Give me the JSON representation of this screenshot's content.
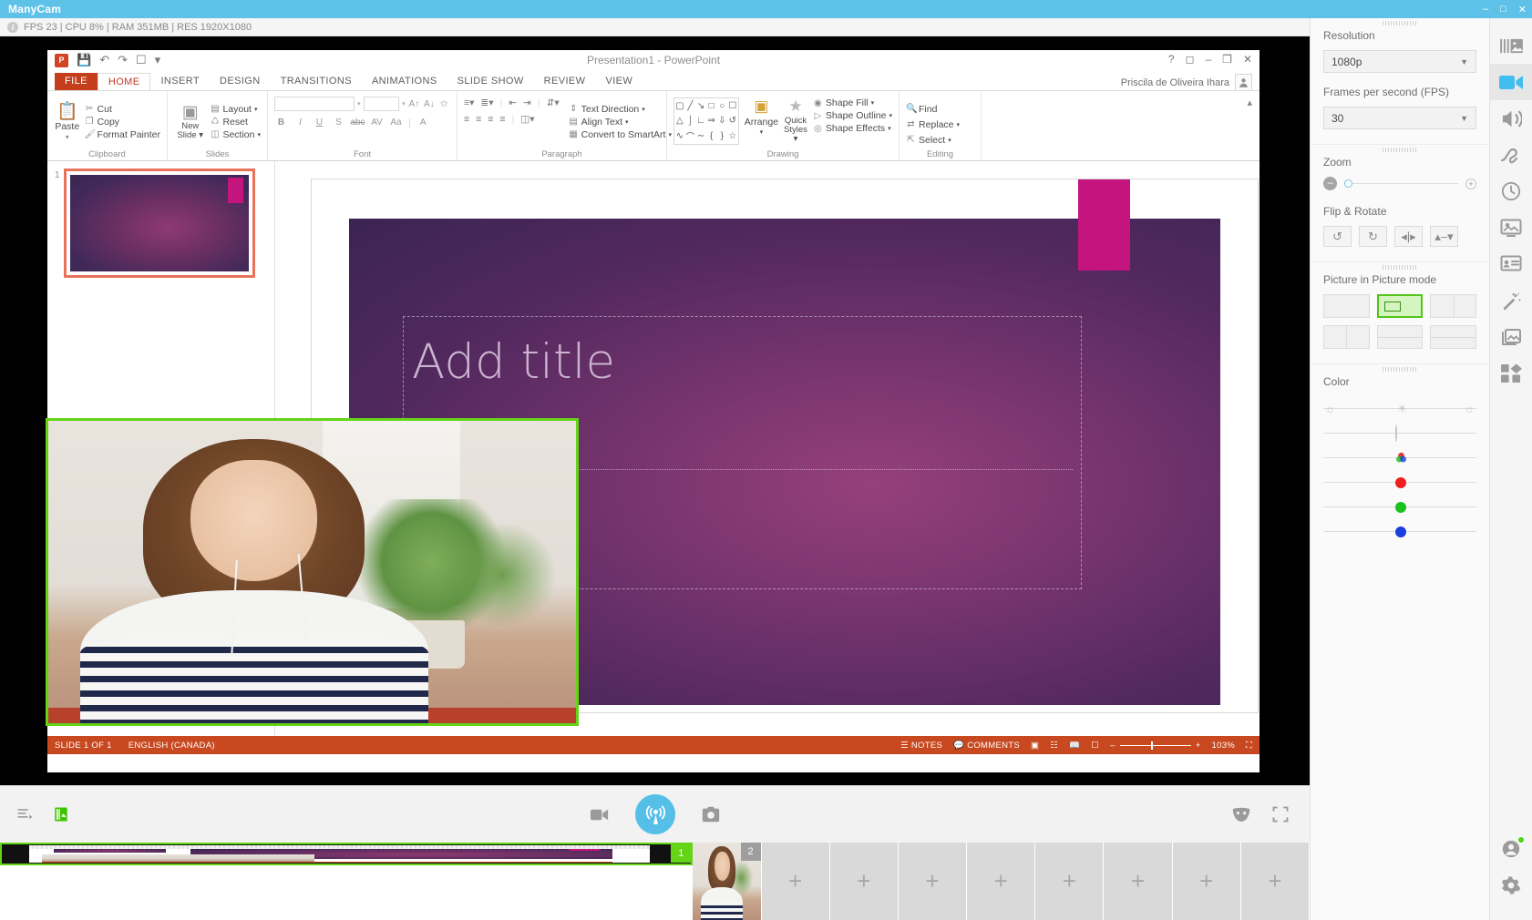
{
  "window": {
    "app_title": "ManyCam",
    "minimize": "–",
    "maximize": "□",
    "close": "✕"
  },
  "stats_bar": {
    "info_icon": "info-icon",
    "text": "FPS 23 | CPU 8% | RAM 351MB | RES 1920X1080"
  },
  "powerpoint": {
    "title": "Presentation1 - PowerPoint",
    "user": "Priscila de Oliveira Ihara",
    "quick_access": [
      "save-icon",
      "undo-icon",
      "redo-icon",
      "start-from-beginning-icon",
      "customize-icon"
    ],
    "window_controls": [
      "help-icon",
      "ribbon-display-icon",
      "minimize-icon",
      "restore-icon",
      "close-icon"
    ],
    "tabs": [
      {
        "label": "FILE",
        "kind": "file"
      },
      {
        "label": "HOME",
        "kind": "active"
      },
      {
        "label": "INSERT",
        "kind": "normal"
      },
      {
        "label": "DESIGN",
        "kind": "normal"
      },
      {
        "label": "TRANSITIONS",
        "kind": "normal"
      },
      {
        "label": "ANIMATIONS",
        "kind": "normal"
      },
      {
        "label": "SLIDE SHOW",
        "kind": "normal"
      },
      {
        "label": "REVIEW",
        "kind": "normal"
      },
      {
        "label": "VIEW",
        "kind": "normal"
      }
    ],
    "ribbon": {
      "clipboard": {
        "name": "Clipboard",
        "paste": "Paste",
        "items": [
          "Cut",
          "Copy",
          "Format Painter"
        ]
      },
      "slides": {
        "name": "Slides",
        "new_slide": "New\nSlide",
        "items": [
          "Layout",
          "Reset",
          "Section"
        ]
      },
      "font": {
        "name": "Font",
        "font_name": "",
        "font_size": "",
        "buttons": [
          "B",
          "I",
          "U",
          "S",
          "abc",
          "AV",
          "Aa",
          "A"
        ]
      },
      "paragraph": {
        "name": "Paragraph",
        "items": [
          "Text Direction",
          "Align Text",
          "Convert to SmartArt"
        ]
      },
      "drawing": {
        "name": "Drawing",
        "arrange": "Arrange",
        "quick_styles": "Quick\nStyles",
        "items": [
          "Shape Fill",
          "Shape Outline",
          "Shape Effects"
        ]
      },
      "editing": {
        "name": "Editing",
        "items": [
          "Find",
          "Replace",
          "Select"
        ]
      }
    },
    "slide_thumbnail_number": "1",
    "slide_title_placeholder": "Add title",
    "status_bar": {
      "slide_count": "SLIDE 1 OF 1",
      "language": "ENGLISH (CANADA)",
      "notes": "NOTES",
      "comments": "COMMENTS",
      "view_icons": [
        "normal-view-icon",
        "slide-sorter-icon",
        "reading-view-icon",
        "slide-show-icon"
      ],
      "zoom_minus": "–",
      "zoom_plus": "+",
      "zoom_level": "103%",
      "fit_icon": "fit-slide-icon"
    }
  },
  "bottom_toolbar": {
    "left": [
      "playlist-icon",
      "effects-layers-icon"
    ],
    "center": [
      "record-video-icon",
      "broadcast-icon",
      "snapshot-icon"
    ],
    "right": [
      "mask-icon",
      "fullscreen-icon"
    ]
  },
  "sources": [
    {
      "number": "1",
      "selected": true,
      "kind": "powerpoint-capture"
    },
    {
      "number": "2",
      "selected": false,
      "kind": "webcam"
    },
    {
      "number": "",
      "selected": false,
      "kind": "add",
      "label": "+"
    },
    {
      "number": "",
      "selected": false,
      "kind": "add",
      "label": "+"
    },
    {
      "number": "",
      "selected": false,
      "kind": "add",
      "label": "+"
    },
    {
      "number": "",
      "selected": false,
      "kind": "add",
      "label": "+"
    },
    {
      "number": "",
      "selected": false,
      "kind": "add",
      "label": "+"
    },
    {
      "number": "",
      "selected": false,
      "kind": "add",
      "label": "+"
    },
    {
      "number": "",
      "selected": false,
      "kind": "add",
      "label": "+"
    },
    {
      "number": "",
      "selected": false,
      "kind": "add",
      "label": "+"
    }
  ],
  "settings_panel": {
    "resolution": {
      "label": "Resolution",
      "value": "1080p"
    },
    "fps": {
      "label": "Frames per second (FPS)",
      "value": "30"
    },
    "zoom": {
      "label": "Zoom",
      "minus": "–",
      "plus": "+",
      "value_pct": 3
    },
    "flip_rotate": {
      "label": "Flip & Rotate",
      "buttons": [
        "rotate-left-icon",
        "rotate-right-icon",
        "flip-horizontal-icon",
        "flip-vertical-icon"
      ]
    },
    "pip": {
      "label": "Picture in Picture mode",
      "options": [
        {
          "name": "pip-mode-fullscreen",
          "selected": false
        },
        {
          "name": "pip-mode-overlay",
          "selected": true
        },
        {
          "name": "pip-mode-side-by-side",
          "selected": false
        },
        {
          "name": "pip-mode-split-vertical",
          "selected": false
        },
        {
          "name": "pip-mode-split-horizontal",
          "selected": false
        },
        {
          "name": "pip-mode-stacked",
          "selected": false
        }
      ]
    },
    "color": {
      "label": "Color",
      "sliders": [
        {
          "name": "brightness",
          "icon": "sun-icon",
          "pos_pct": 48,
          "color": "#e2e2e2"
        },
        {
          "name": "contrast",
          "icon": "contrast-icon",
          "pos_pct": 48,
          "color": "#c4c4c4"
        },
        {
          "name": "saturation",
          "icon": "rgb-icon",
          "pos_pct": 48,
          "color": "#4caf50"
        },
        {
          "name": "red",
          "icon": "dot-icon",
          "pos_pct": 48,
          "color": "#f02020"
        },
        {
          "name": "green",
          "icon": "dot-icon",
          "pos_pct": 48,
          "color": "#1bc21b"
        },
        {
          "name": "blue",
          "icon": "dot-icon",
          "pos_pct": 48,
          "color": "#1a3fe0"
        }
      ]
    }
  },
  "rail": {
    "items": [
      {
        "name": "playlist-rail-icon",
        "active": false
      },
      {
        "name": "video-rail-icon",
        "active": true
      },
      {
        "name": "audio-rail-icon",
        "active": false
      },
      {
        "name": "draw-rail-icon",
        "active": false
      },
      {
        "name": "scheduler-rail-icon",
        "active": false
      },
      {
        "name": "chroma-key-rail-icon",
        "active": false
      },
      {
        "name": "lower-third-rail-icon",
        "active": false
      },
      {
        "name": "effects-rail-icon",
        "active": false
      },
      {
        "name": "backgrounds-rail-icon",
        "active": false
      },
      {
        "name": "overlays-rail-icon",
        "active": false
      }
    ],
    "bottom": [
      {
        "name": "account-rail-icon",
        "active": false,
        "online": true
      },
      {
        "name": "settings-rail-icon",
        "active": false
      }
    ]
  },
  "colors": {
    "titlebar": "#5ec2e8",
    "broadcast": "#55bfe8",
    "selection_green": "#64d416",
    "ppt_accent": "#c8491f",
    "slide_pink": "#c4157e"
  }
}
